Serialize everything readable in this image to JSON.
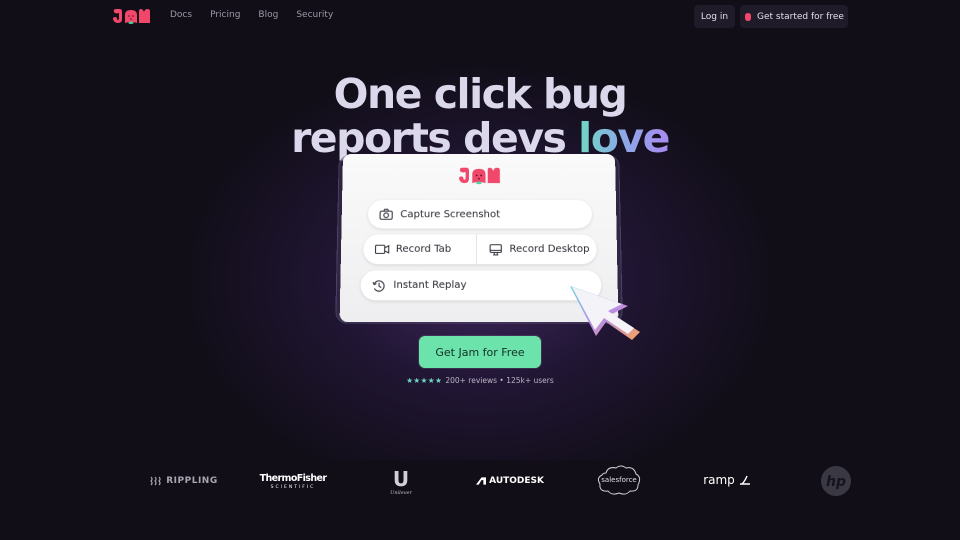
{
  "brand": {
    "name": "JAM",
    "primary_color": "#f0476b",
    "accent_color": "#6be3aa"
  },
  "nav": {
    "links": [
      {
        "label": "Docs"
      },
      {
        "label": "Pricing"
      },
      {
        "label": "Blog"
      },
      {
        "label": "Security"
      }
    ],
    "login_label": "Log in",
    "get_started_label": "Get started for free",
    "get_started_icon": "strawberry-icon"
  },
  "hero": {
    "headline_line1": "One click bug",
    "headline_line2_prefix": "reports devs ",
    "headline_line2_highlight": "love",
    "card": {
      "logo": "JAM",
      "capture_label": "Capture Screenshot",
      "capture_icon": "camera-icon",
      "record_tab_label": "Record Tab",
      "record_tab_icon": "video-camera-icon",
      "record_desktop_label": "Record Desktop",
      "record_desktop_icon": "monitor-icon",
      "instant_replay_label": "Instant Replay",
      "instant_replay_icon": "history-icon"
    },
    "cursor_icon": "pointer-cursor-icon",
    "cta_label": "Get Jam for Free",
    "stars_text": "★★★★★",
    "rating_stars": 5,
    "reviews_text": "200+ reviews • 125k+ users"
  },
  "logos": {
    "rippling": "RIPPLING",
    "thermo_line1": "ThermoFisher",
    "thermo_line2": "SCIENTIFIC",
    "unilever_mark": "U",
    "unilever_word": "Unilever",
    "autodesk": "AUTODESK",
    "salesforce": "salesforce",
    "ramp": "ramp",
    "hp": "hp"
  }
}
